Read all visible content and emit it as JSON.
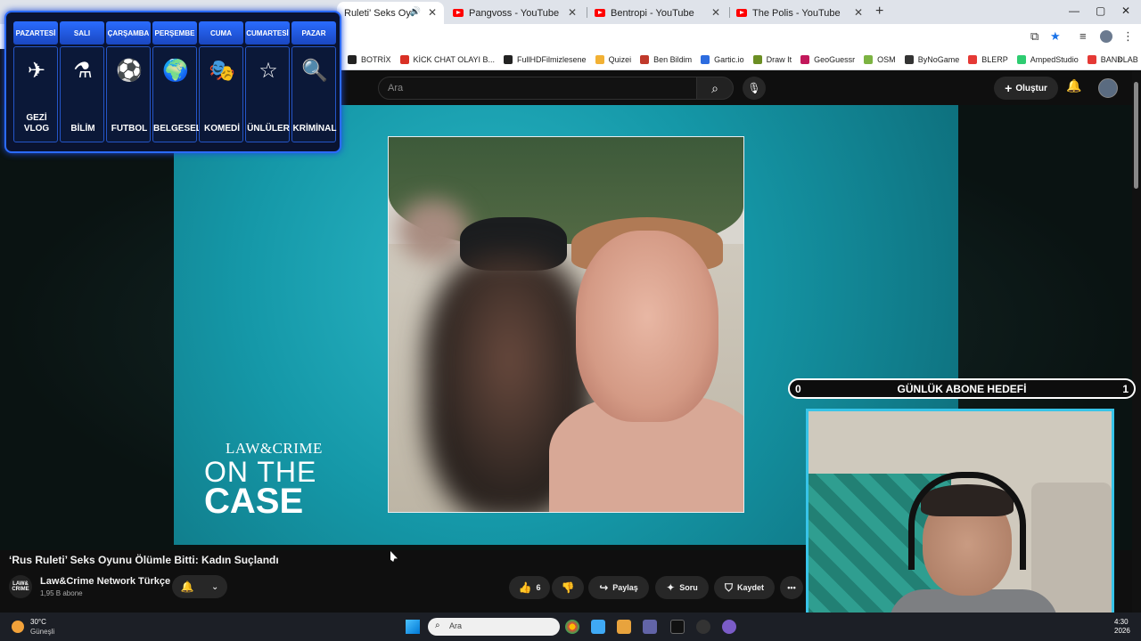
{
  "browser": {
    "tabs": [
      {
        "title": "Ruleti' Seks Oyunu Öl",
        "active": true
      },
      {
        "title": "Pangvoss - YouTube",
        "active": false
      },
      {
        "title": "Bentropi - YouTube",
        "active": false
      },
      {
        "title": "The Polis - YouTube",
        "active": false
      }
    ],
    "new_tab": "+",
    "window_controls": {
      "minimize": "—",
      "maximize": "▢",
      "close": "✕"
    },
    "bookmarks": [
      {
        "label": "BOTRİX",
        "color": "#222222"
      },
      {
        "label": "KİCK CHAT OLAYI B...",
        "color": "#d93025"
      },
      {
        "label": "FullHDFilmizlesene",
        "color": "#222222"
      },
      {
        "label": "Quizei",
        "color": "#f2b134"
      },
      {
        "label": "Ben Bildim",
        "color": "#c0392b"
      },
      {
        "label": "Gartic.io",
        "color": "#2d6cdf"
      },
      {
        "label": "Draw It",
        "color": "#6b8e23"
      },
      {
        "label": "GeoGuessr",
        "color": "#c2185b"
      },
      {
        "label": "OSM",
        "color": "#7cb342"
      },
      {
        "label": "ByNoGame",
        "color": "#333333"
      },
      {
        "label": "BLERP",
        "color": "#e53935"
      },
      {
        "label": "AmpedStudio",
        "color": "#2ecc71"
      },
      {
        "label": "BANDLAB",
        "color": "#e53935"
      }
    ],
    "bookmarks_more": "»"
  },
  "youtube": {
    "search_placeholder": "Ara",
    "create_label": "Oluştur",
    "video_title": "‘Rus Ruleti’ Seks Oyunu Ölümle Bitti: Kadın Suçlandı",
    "channel_name": "Law&Crime Network Türkçe",
    "channel_avatar_text": "LAW& CRIME",
    "subscribers": "1,95 B abone",
    "likes": "6",
    "share_label": "Paylaş",
    "ask_label": "Soru",
    "save_label": "Kaydet",
    "more_label": "•••"
  },
  "video_overlay": {
    "logo_line1": "LAW&CRIME",
    "logo_line2": "ON THE",
    "logo_line3": "CASE"
  },
  "schedule": {
    "days": [
      {
        "day": "PAZARTESİ",
        "label": "GEZİ VLOG",
        "icon": "✈"
      },
      {
        "day": "SALI",
        "label": "BİLİM",
        "icon": "⚗"
      },
      {
        "day": "ÇARŞAMBA",
        "label": "FUTBOL",
        "icon": "⚽"
      },
      {
        "day": "PERŞEMBE",
        "label": "BELGESEL",
        "icon": "🌍"
      },
      {
        "day": "CUMA",
        "label": "KOMEDİ",
        "icon": "🎭"
      },
      {
        "day": "CUMARTESİ",
        "label": "ÜNLÜLER",
        "icon": "☆"
      },
      {
        "day": "PAZAR",
        "label": "KRİMİNAL",
        "icon": "🔍"
      }
    ]
  },
  "goal": {
    "title": "GÜNLÜK ABONE HEDEFİ",
    "current": "0",
    "target": "1"
  },
  "taskbar": {
    "temperature": "30°C",
    "condition": "Güneşli",
    "search_placeholder": "Ara",
    "time": "4:30",
    "date": "2026"
  },
  "colors": {
    "accent_blue": "#2b6bff",
    "youtube_red": "#ff0000",
    "webcam_border": "#37c4e8"
  }
}
